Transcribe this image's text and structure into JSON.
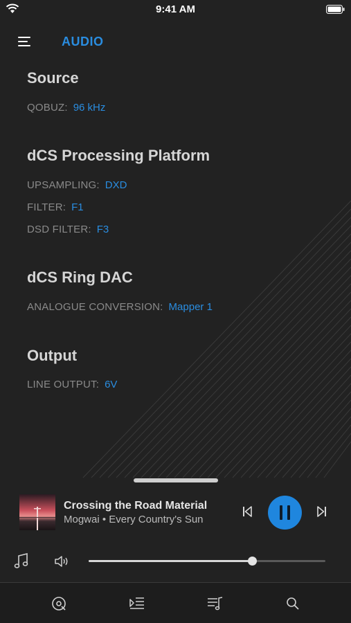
{
  "status_bar": {
    "time": "9:41 AM"
  },
  "header": {
    "title": "AUDIO"
  },
  "sections": {
    "source": {
      "title": "Source",
      "rows": [
        {
          "label": "QOBUZ:",
          "value": "96 kHz"
        }
      ]
    },
    "processing": {
      "title": "dCS Processing Platform",
      "rows": [
        {
          "label": "UPSAMPLING:",
          "value": "DXD"
        },
        {
          "label": "FILTER:",
          "value": "F1"
        },
        {
          "label": "DSD FILTER:",
          "value": "F3"
        }
      ]
    },
    "dac": {
      "title": "dCS Ring DAC",
      "rows": [
        {
          "label": "ANALOGUE CONVERSION:",
          "value": "Mapper 1"
        }
      ]
    },
    "output": {
      "title": "Output",
      "rows": [
        {
          "label": "LINE OUTPUT:",
          "value": "6V"
        }
      ]
    }
  },
  "now_playing": {
    "title": "Crossing the Road Material",
    "subtitle": "Mogwai • Every Country's Sun",
    "state": "playing"
  },
  "volume": {
    "level": 0.69
  },
  "tabs": [
    {
      "icon": "vinyl-icon"
    },
    {
      "icon": "queue-icon"
    },
    {
      "icon": "library-icon"
    },
    {
      "icon": "search-icon"
    }
  ],
  "colors": {
    "accent": "#2a8de0",
    "background": "#222222",
    "play_button": "#1f86de"
  }
}
